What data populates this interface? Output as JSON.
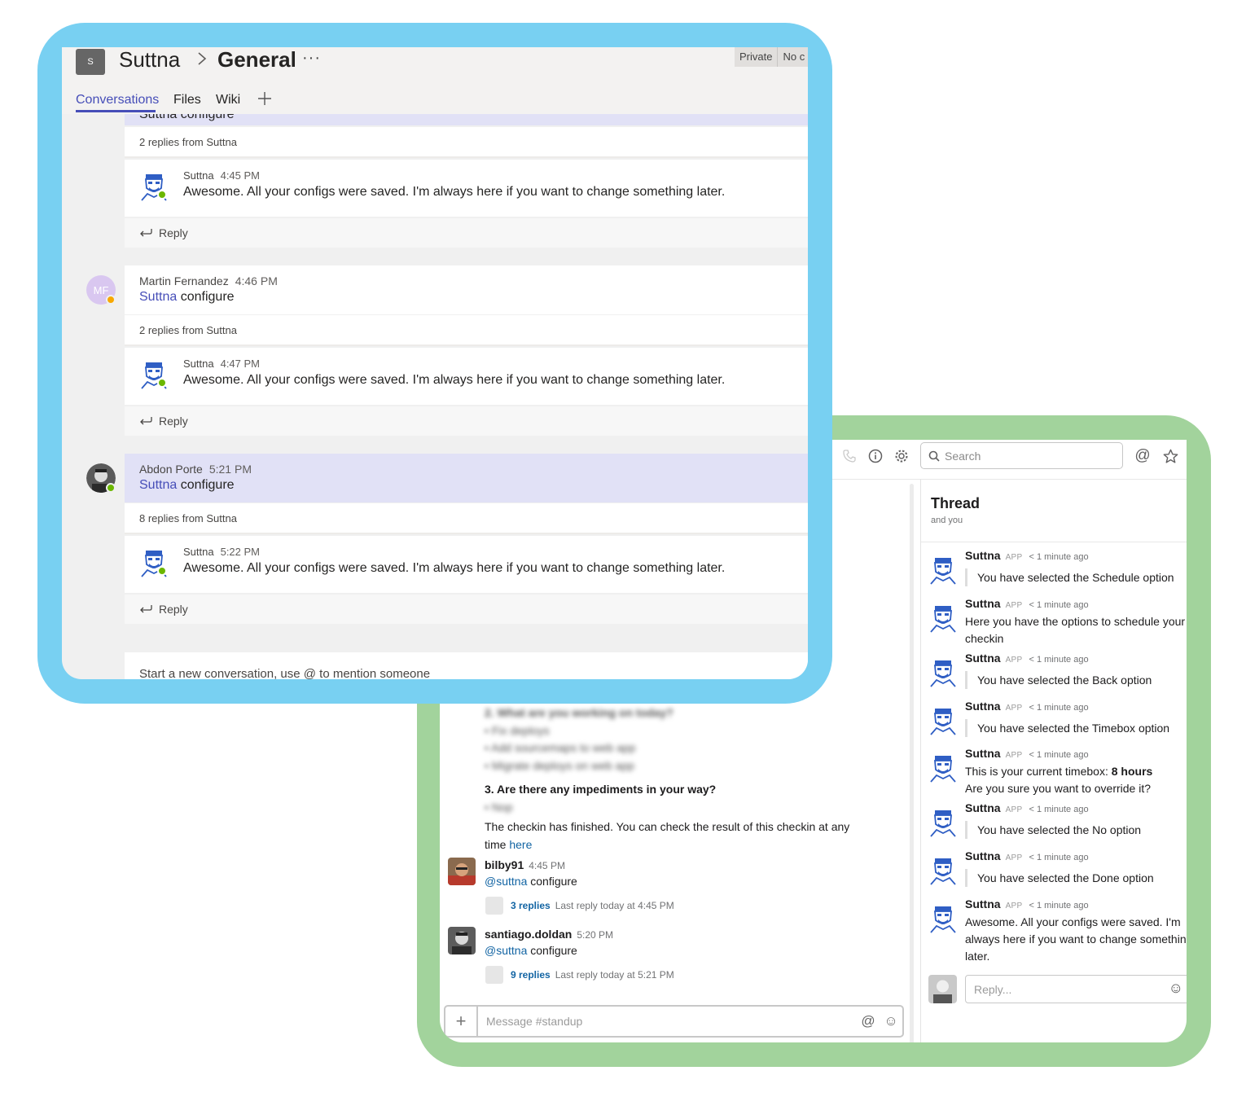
{
  "slack": {
    "toolbar": {
      "search_placeholder": "Search"
    },
    "channel_messages": {
      "blurred_lines": [
        "2. What are you working on today?",
        "• Fix deploys",
        "• Add sourcemaps to web app",
        "• Migrate deploys on web app",
        "• Nop"
      ],
      "question3": "3. Are there any impediments in your way?",
      "finished_text": "The checkin has finished. You can check the result of this checkin at any",
      "finished_text_2": "time",
      "finished_link": "here",
      "posts": [
        {
          "user": "bilby91",
          "time": "4:45 PM",
          "mention": "@suttna",
          "text": "configure",
          "replies": "3 replies",
          "last_reply": "Last reply today at 4:45 PM"
        },
        {
          "user": "santiago.doldan",
          "time": "5:20 PM",
          "mention": "@suttna",
          "text": "configure",
          "replies": "9 replies",
          "last_reply": "Last reply today at 5:21 PM"
        }
      ],
      "composer_placeholder": "Message #standup"
    },
    "thread": {
      "title": "Thread",
      "subtitle": "and you",
      "app_badge": "APP",
      "messages": [
        {
          "author": "Suttna",
          "ago": "< 1 minute ago",
          "text": "You have selected the Schedule option"
        },
        {
          "author": "Suttna",
          "ago": "< 1 minute ago",
          "text": "Here you have the options to schedule your checkin"
        },
        {
          "author": "Suttna",
          "ago": "< 1 minute ago",
          "text": "You have selected the Back option"
        },
        {
          "author": "Suttna",
          "ago": "< 1 minute ago",
          "text": "You have selected the Timebox option"
        },
        {
          "author": "Suttna",
          "ago": "< 1 minute ago",
          "text": "This is your current timebox:",
          "bold": "8 hours",
          "text2": "Are you sure you want to override it?"
        },
        {
          "author": "Suttna",
          "ago": "< 1 minute ago",
          "text": "You have selected the No option"
        },
        {
          "author": "Suttna",
          "ago": "< 1 minute ago",
          "text": "You have selected the Done option"
        },
        {
          "author": "Suttna",
          "ago": "< 1 minute ago",
          "text": "Awesome. All your configs were saved. I'm always here if you want to change something later."
        }
      ],
      "reply_placeholder": "Reply..."
    }
  },
  "teams": {
    "team_initial": "S",
    "team_name": "Suttna",
    "channel_name": "General",
    "more": "···",
    "badges": [
      "Private",
      "No c"
    ],
    "tabs": [
      "Conversations",
      "Files",
      "Wiki"
    ],
    "partial_top_text": "Suttna configure",
    "threads": [
      {
        "replies_label": "2 replies from Suttna",
        "bot_name": "Suttna",
        "bot_time": "4:45 PM",
        "bot_text": "Awesome. All your configs were saved. I'm always here if you want to change something later.",
        "reply_label": "Reply"
      },
      {
        "author": "Martin Fernandez",
        "author_initials": "MF",
        "time": "4:46 PM",
        "mention": "Suttna",
        "text": "configure",
        "replies_label": "2 replies from Suttna",
        "bot_name": "Suttna",
        "bot_time": "4:47 PM",
        "bot_text": "Awesome. All your configs were saved. I'm always here if you want to change something later.",
        "reply_label": "Reply"
      },
      {
        "author": "Abdon Porte",
        "time": "5:21 PM",
        "mention": "Suttna",
        "text": "configure",
        "replies_label": "8 replies from Suttna",
        "bot_name": "Suttna",
        "bot_time": "5:22 PM",
        "bot_text": "Awesome. All your configs were saved. I'm always here if you want to change something later.",
        "reply_label": "Reply"
      }
    ],
    "new_conversation": "Start a new conversation, use @ to mention someone"
  },
  "colors": {
    "teams_frame": "#78d0f2",
    "slack_frame": "#a2d39c",
    "teams_accent": "#464eb8",
    "slack_link": "#1264a3"
  }
}
